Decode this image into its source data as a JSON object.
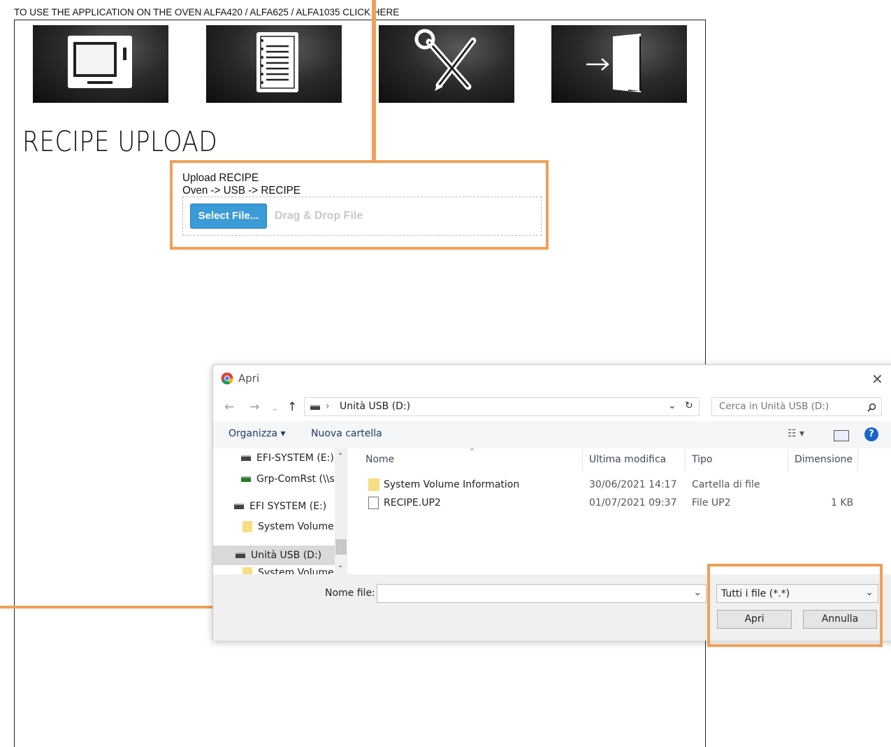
{
  "top_link": "TO USE THE APPLICATION ON THE OVEN ALFA420 / ALFA625 / ALFA1035 CLICK HERE",
  "nav_tiles": [
    {
      "icon": "oven-icon"
    },
    {
      "icon": "notebook-icon"
    },
    {
      "icon": "tools-icon"
    },
    {
      "icon": "exit-door-icon"
    }
  ],
  "page_title": "RECIPE UPLOAD",
  "upload": {
    "line1": "Upload RECIPE",
    "line2": "Oven -> USB -> RECIPE",
    "select_button": "Select File...",
    "drag_text": "Drag & Drop File"
  },
  "dialog": {
    "title": "Apri",
    "address": "Unità USB (D:)",
    "search_placeholder": "Cerca in Unità USB (D:)",
    "toolbar": {
      "organize": "Organizza ▾",
      "new_folder": "Nuova cartella"
    },
    "nav_items": [
      {
        "label": "EFI-SYSTEM (E:)",
        "icon": "drive-icon"
      },
      {
        "label": "Grp-ComRst (\\\\s",
        "icon": "network-drive-icon"
      },
      {
        "label": "EFI SYSTEM (E:)",
        "icon": "drive-icon"
      },
      {
        "label": "System Volume I",
        "icon": "folder-icon"
      },
      {
        "label": "Unità USB (D:)",
        "icon": "drive-icon"
      },
      {
        "label": "System Volume I",
        "icon": "folder-icon"
      }
    ],
    "columns": {
      "name": "Nome",
      "modified": "Ultima modifica",
      "type": "Tipo",
      "size": "Dimensione"
    },
    "files": [
      {
        "name": "System Volume Information",
        "modified": "30/06/2021 14:17",
        "type": "Cartella di file",
        "size": "",
        "icon": "folder-icon"
      },
      {
        "name": "RECIPE.UP2",
        "modified": "01/07/2021 09:37",
        "type": "File UP2",
        "size": "1 KB",
        "icon": "file-icon"
      }
    ],
    "filename_label": "Nome file:",
    "filename_value": "",
    "filter": "Tutti i file (*.*)",
    "open_button": "Apri",
    "cancel_button": "Annulla"
  },
  "colors": {
    "accent_orange": "#f0a05a",
    "button_blue": "#3b9bd6"
  }
}
